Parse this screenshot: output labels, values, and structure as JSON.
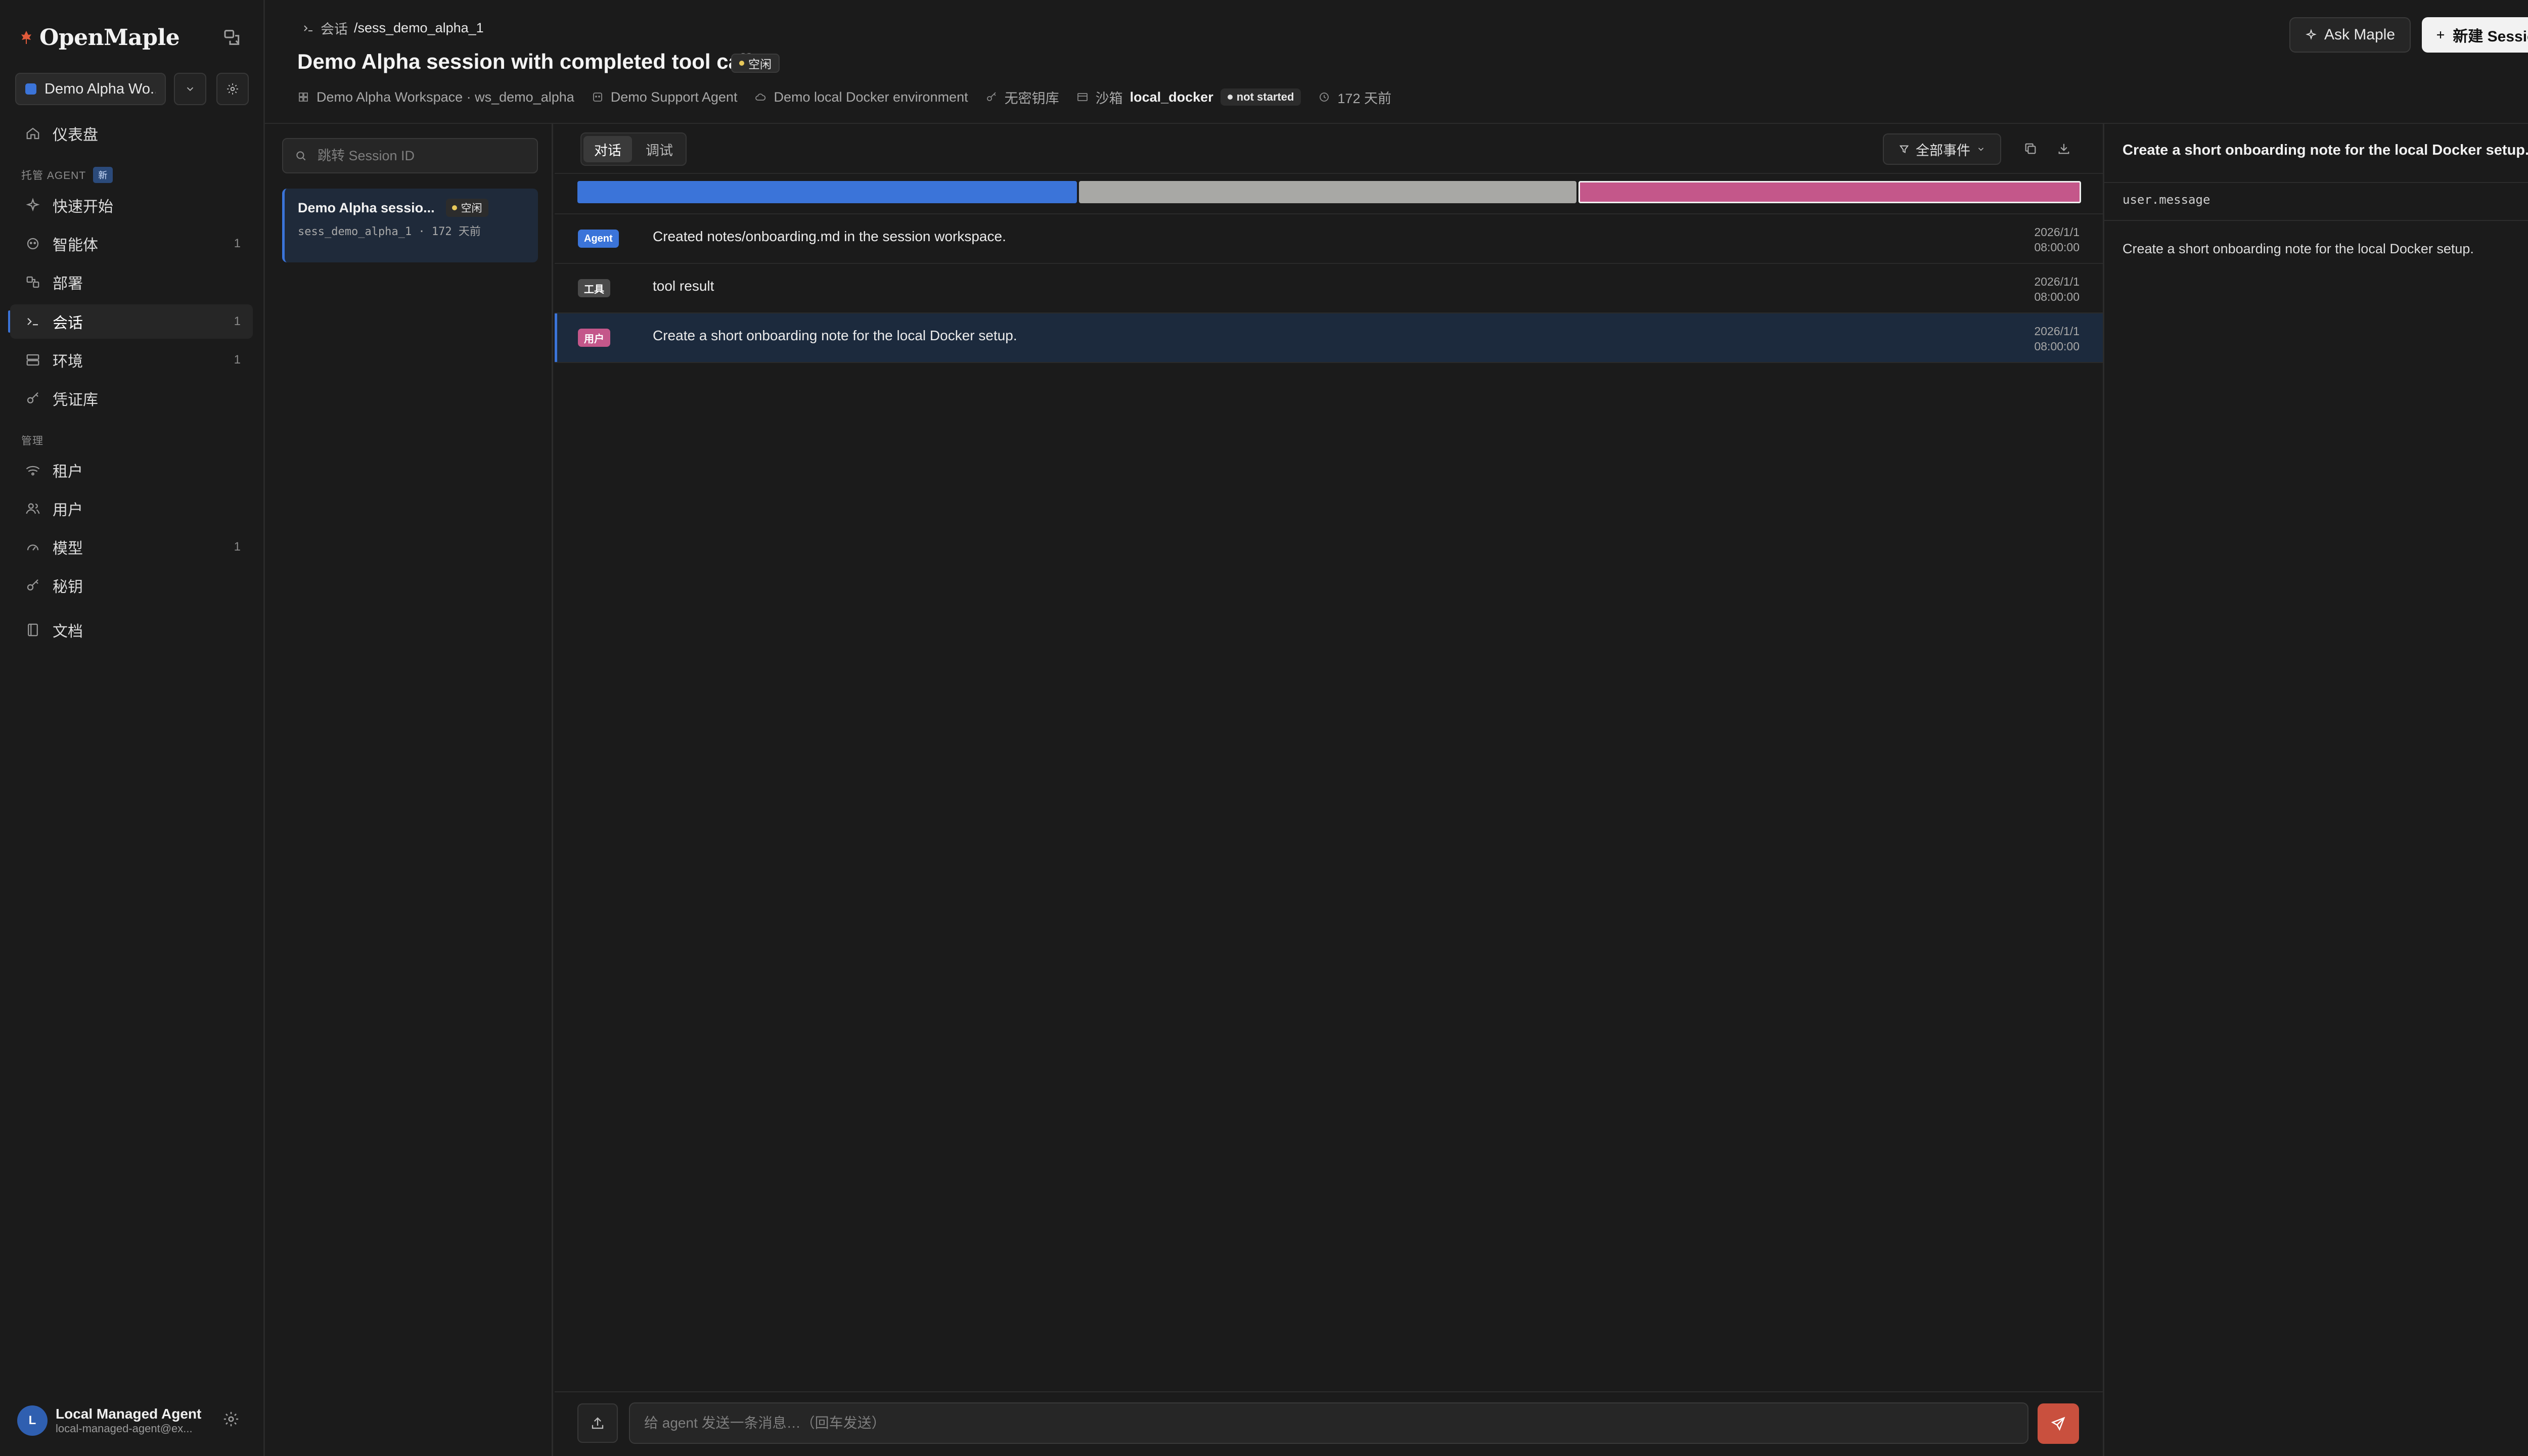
{
  "app": {
    "logo": "OpenMaple"
  },
  "sidebar": {
    "workspace": {
      "label": "Demo Alpha Wo...",
      "color": "#3b74d9"
    },
    "dashboard": {
      "label": "仪表盘"
    },
    "managed_agent_section": {
      "label": "托管 AGENT",
      "badge": "新"
    },
    "managed_items": [
      {
        "label": "快速开始",
        "count": ""
      },
      {
        "label": "智能体",
        "count": "1"
      },
      {
        "label": "部署",
        "count": ""
      },
      {
        "label": "会话",
        "count": "1",
        "active": true
      },
      {
        "label": "环境",
        "count": "1"
      },
      {
        "label": "凭证库",
        "count": ""
      }
    ],
    "admin_section": {
      "label": "管理"
    },
    "admin_items": [
      {
        "label": "租户",
        "count": ""
      },
      {
        "label": "用户",
        "count": ""
      },
      {
        "label": "模型",
        "count": "1"
      },
      {
        "label": "秘钥",
        "count": ""
      }
    ],
    "docs": {
      "label": "文档"
    },
    "user": {
      "initial": "L",
      "name": "Local Managed Agent",
      "email": "local-managed-agent@ex..."
    }
  },
  "header": {
    "breadcrumb": {
      "section": "会话",
      "current": "/sess_demo_alpha_1"
    },
    "title": "Demo Alpha session with completed tool call",
    "status": "空闲",
    "meta": {
      "workspace": "Demo Alpha Workspace · ws_demo_alpha",
      "agent": "Demo Support Agent",
      "environment": "Demo local Docker environment",
      "vault": "无密钥库",
      "sandbox_label": "沙箱",
      "sandbox_name": "local_docker",
      "sandbox_status": "not started",
      "age": "172 天前"
    },
    "ask_button": "Ask Maple",
    "new_button": "新建 Session"
  },
  "sessions": {
    "search_placeholder": "跳转 Session ID",
    "items": [
      {
        "name": "Demo Alpha sessio...",
        "status": "空闲",
        "sub": "sess_demo_alpha_1 · 172 天前"
      }
    ]
  },
  "events": {
    "tabs": [
      "对话",
      "调试"
    ],
    "active_tab": "对话",
    "filter_label": "全部事件",
    "timeline_colors": [
      "#3b74d9",
      "#a8a8a5",
      "#c4578a"
    ],
    "rows": [
      {
        "badge": "Agent",
        "badge_color": "#3b74d9",
        "text": "Created notes/onboarding.md in the session workspace.",
        "date": "2026/1/1",
        "time": "08:00:00"
      },
      {
        "badge": "工具",
        "badge_color": "#4a4a4a",
        "text": "tool result",
        "date": "2026/1/1",
        "time": "08:00:00"
      },
      {
        "badge": "用户",
        "badge_color": "#c4578a",
        "text": "Create a short onboarding note for the local Docker setup.",
        "date": "2026/1/1",
        "time": "08:00:00",
        "selected": true
      }
    ],
    "composer_placeholder": "给 agent 发送一条消息…（回车发送）"
  },
  "detail": {
    "title": "Create a short onboarding note for the local Docker setup.",
    "type": "user.message",
    "body": "Create a short onboarding note for the local Docker setup."
  }
}
